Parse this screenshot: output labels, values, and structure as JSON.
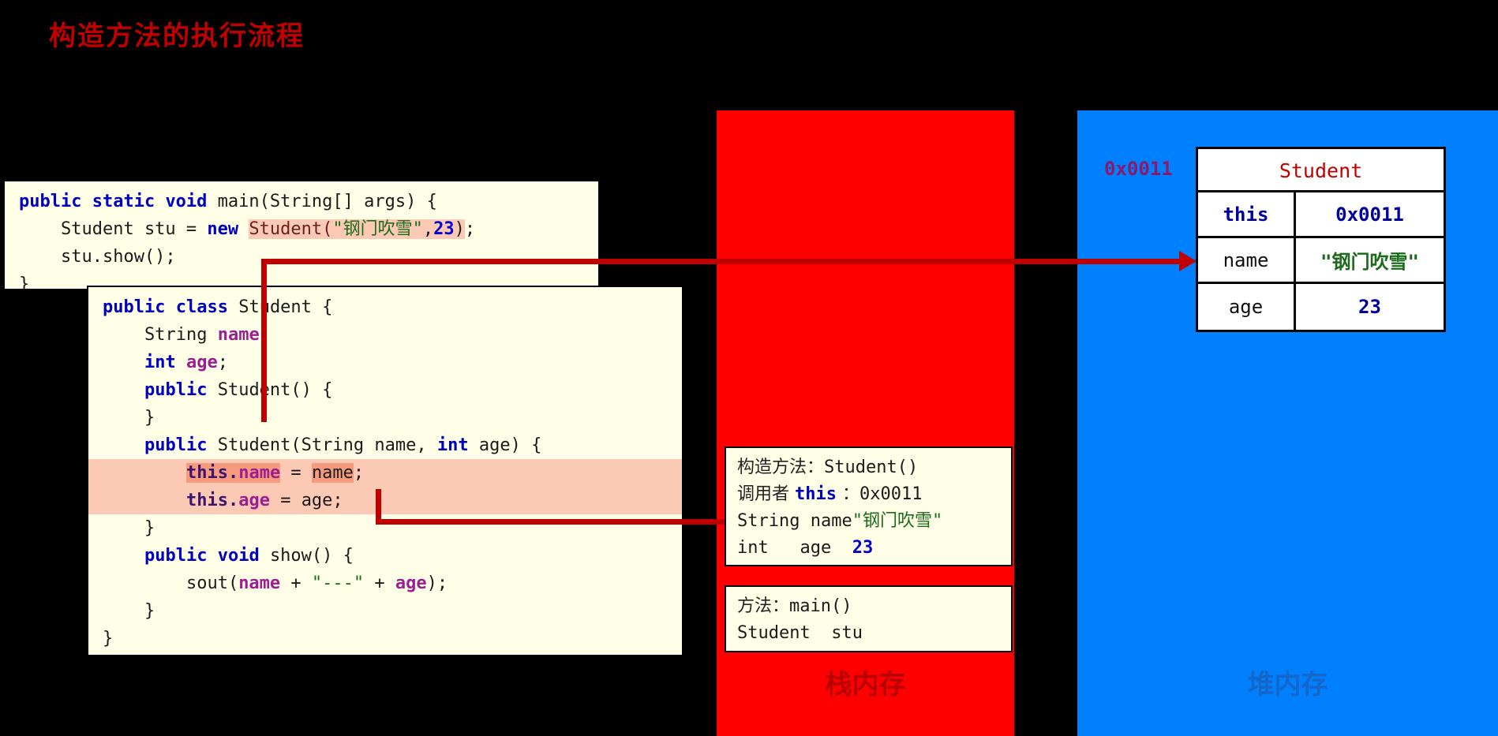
{
  "title": "构造方法的执行流程",
  "panels": {
    "stack": {
      "caption": "栈内存",
      "color": "#FF0000"
    },
    "heap": {
      "caption": "堆内存",
      "color": "#0080FF"
    }
  },
  "code_main": {
    "name": "main-method-code",
    "lines": [
      {
        "id": "l1",
        "parts": [
          {
            "t": "public ",
            "c": "kw"
          },
          {
            "t": "static ",
            "c": "kw"
          },
          {
            "t": "void ",
            "c": "kw"
          },
          {
            "t": "main(String[] args) {",
            "c": "plain"
          }
        ]
      },
      {
        "id": "l2",
        "parts": [
          {
            "t": "    Student stu = ",
            "c": "plain"
          },
          {
            "t": "new ",
            "c": "kw"
          },
          {
            "t": "Student(",
            "c": "ctor",
            "m": "peach"
          },
          {
            "t": "\"钢门吹雪\"",
            "c": "str",
            "m": "peach"
          },
          {
            "t": ",",
            "c": "plain",
            "m": "peach"
          },
          {
            "t": "23",
            "c": "num",
            "m": "peach"
          },
          {
            "t": ")",
            "c": "plain",
            "m": "peach"
          },
          {
            "t": ";",
            "c": "plain"
          }
        ]
      },
      {
        "id": "l3",
        "parts": [
          {
            "t": "    stu.show();",
            "c": "plain"
          }
        ]
      },
      {
        "id": "l4",
        "parts": [
          {
            "t": "}",
            "c": "plain"
          }
        ]
      }
    ]
  },
  "code_class": {
    "name": "student-class-code",
    "lines": [
      {
        "id": "c1",
        "parts": [
          {
            "t": "public ",
            "c": "kw"
          },
          {
            "t": "class ",
            "c": "kw"
          },
          {
            "t": "Student {",
            "c": "plain"
          }
        ]
      },
      {
        "id": "c2",
        "parts": [
          {
            "t": "    String ",
            "c": "plain"
          },
          {
            "t": "name",
            "c": "fld"
          },
          {
            "t": ";",
            "c": "plain"
          }
        ]
      },
      {
        "id": "c3",
        "parts": [
          {
            "t": "    ",
            "c": "plain"
          },
          {
            "t": "int ",
            "c": "kw"
          },
          {
            "t": "age",
            "c": "fld"
          },
          {
            "t": ";",
            "c": "plain"
          }
        ]
      },
      {
        "id": "c4",
        "parts": [
          {
            "t": "    ",
            "c": "plain"
          },
          {
            "t": "public ",
            "c": "kw"
          },
          {
            "t": "Student() {",
            "c": "plain"
          }
        ]
      },
      {
        "id": "c5",
        "parts": [
          {
            "t": "    }",
            "c": "plain"
          }
        ]
      },
      {
        "id": "c6",
        "parts": [
          {
            "t": "    ",
            "c": "plain"
          },
          {
            "t": "public ",
            "c": "kw"
          },
          {
            "t": "Student(String name, ",
            "c": "plain"
          },
          {
            "t": "int ",
            "c": "kw"
          },
          {
            "t": "age) {",
            "c": "plain"
          }
        ]
      },
      {
        "id": "c7",
        "hl": true,
        "parts": [
          {
            "t": "        ",
            "c": "plain"
          },
          {
            "t": "this",
            "c": "thisk",
            "m": "salmon"
          },
          {
            "t": ".",
            "c": "thisk",
            "m": "salmon"
          },
          {
            "t": "name",
            "c": "fld",
            "m": "salmon"
          },
          {
            "t": " = ",
            "c": "plain"
          },
          {
            "t": "name",
            "c": "plain",
            "m": "salmon"
          },
          {
            "t": ";",
            "c": "plain"
          }
        ]
      },
      {
        "id": "c8",
        "hl": true,
        "parts": [
          {
            "t": "        ",
            "c": "plain"
          },
          {
            "t": "this",
            "c": "thisk"
          },
          {
            "t": ".",
            "c": "thisk"
          },
          {
            "t": "age",
            "c": "fld"
          },
          {
            "t": " = age;",
            "c": "plain"
          }
        ]
      },
      {
        "id": "c9",
        "parts": [
          {
            "t": "    }",
            "c": "plain"
          }
        ]
      },
      {
        "id": "c10",
        "parts": [
          {
            "t": "    ",
            "c": "plain"
          },
          {
            "t": "public ",
            "c": "kw"
          },
          {
            "t": "void ",
            "c": "kw"
          },
          {
            "t": "show() {",
            "c": "plain"
          }
        ]
      },
      {
        "id": "c11",
        "parts": [
          {
            "t": "        sout(",
            "c": "plain"
          },
          {
            "t": "name",
            "c": "fld"
          },
          {
            "t": " + ",
            "c": "plain"
          },
          {
            "t": "\"---\"",
            "c": "str"
          },
          {
            "t": " + ",
            "c": "plain"
          },
          {
            "t": "age",
            "c": "fld"
          },
          {
            "t": ");",
            "c": "plain"
          }
        ]
      },
      {
        "id": "c12",
        "parts": [
          {
            "t": "    }",
            "c": "plain"
          }
        ]
      },
      {
        "id": "c13",
        "parts": [
          {
            "t": "}",
            "c": "plain"
          }
        ]
      }
    ]
  },
  "frames": [
    {
      "id": "constructor-frame",
      "lines": [
        {
          "parts": [
            {
              "t": "构造方法：",
              "c": "cn"
            },
            {
              "t": "Student()",
              "c": "plain"
            }
          ]
        },
        {
          "parts": [
            {
              "t": "调用者 ",
              "c": "cn"
            },
            {
              "t": "this",
              "c": "kw"
            },
            {
              "t": " ：",
              "c": "cn"
            },
            {
              "t": "0x0011",
              "c": "plain"
            }
          ]
        },
        {
          "parts": [
            {
              "t": "String name",
              "c": "plain"
            },
            {
              "t": "\"钢门吹雪\"",
              "c": "str"
            }
          ]
        },
        {
          "parts": [
            {
              "t": "int   age  ",
              "c": "plain"
            },
            {
              "t": "23",
              "c": "num"
            }
          ]
        }
      ]
    },
    {
      "id": "main-frame",
      "lines": [
        {
          "parts": [
            {
              "t": "方法：",
              "c": "cn"
            },
            {
              "t": "main()",
              "c": "plain"
            }
          ]
        },
        {
          "parts": [
            {
              "t": "Student  stu",
              "c": "plain"
            }
          ]
        }
      ]
    }
  ],
  "heap": {
    "address_label": "0x0011",
    "object": {
      "header": "Student",
      "rows": [
        {
          "key": "this",
          "key_style": "b",
          "value": "0x0011",
          "value_style": "v-addr"
        },
        {
          "key": "name",
          "key_style": "",
          "value": "\"钢门吹雪\"",
          "value_style": "v-str"
        },
        {
          "key": "age",
          "key_style": "",
          "value": "23",
          "value_style": "v-num"
        }
      ]
    }
  },
  "colors": {
    "title": "#C00000",
    "stack_bg": "#FF0000",
    "heap_bg": "#0080FF",
    "code_bg": "#FFFFE8",
    "arrow": "#C00000",
    "highlight_peach": "#FBC9B4",
    "highlight_salmon": "#F79B7E"
  }
}
